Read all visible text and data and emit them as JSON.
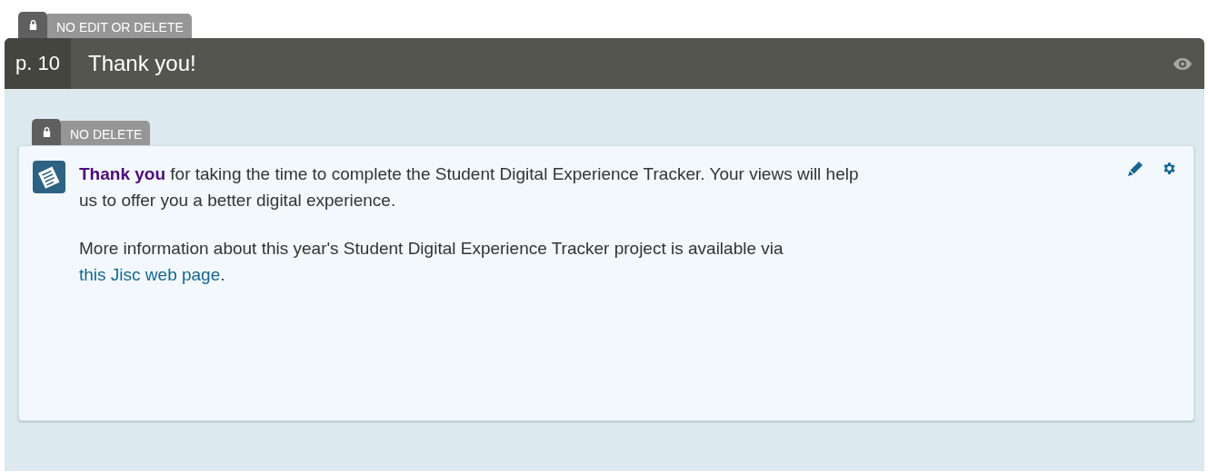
{
  "page_lock": {
    "label": "NO EDIT OR DELETE"
  },
  "page": {
    "number": "p. 10",
    "title": "Thank you!"
  },
  "block_lock": {
    "label": "NO DELETE"
  },
  "block": {
    "paragraphs": [
      {
        "text": "**Thank you** for taking the time to complete the Student Digital Experience Tracker. Your views will help us to offer you a better digital experience."
      },
      {
        "text": "More information about this year's Student Digital Experience Tracker project is available via",
        "link": "this Jisc web page",
        "after": "."
      }
    ]
  }
}
